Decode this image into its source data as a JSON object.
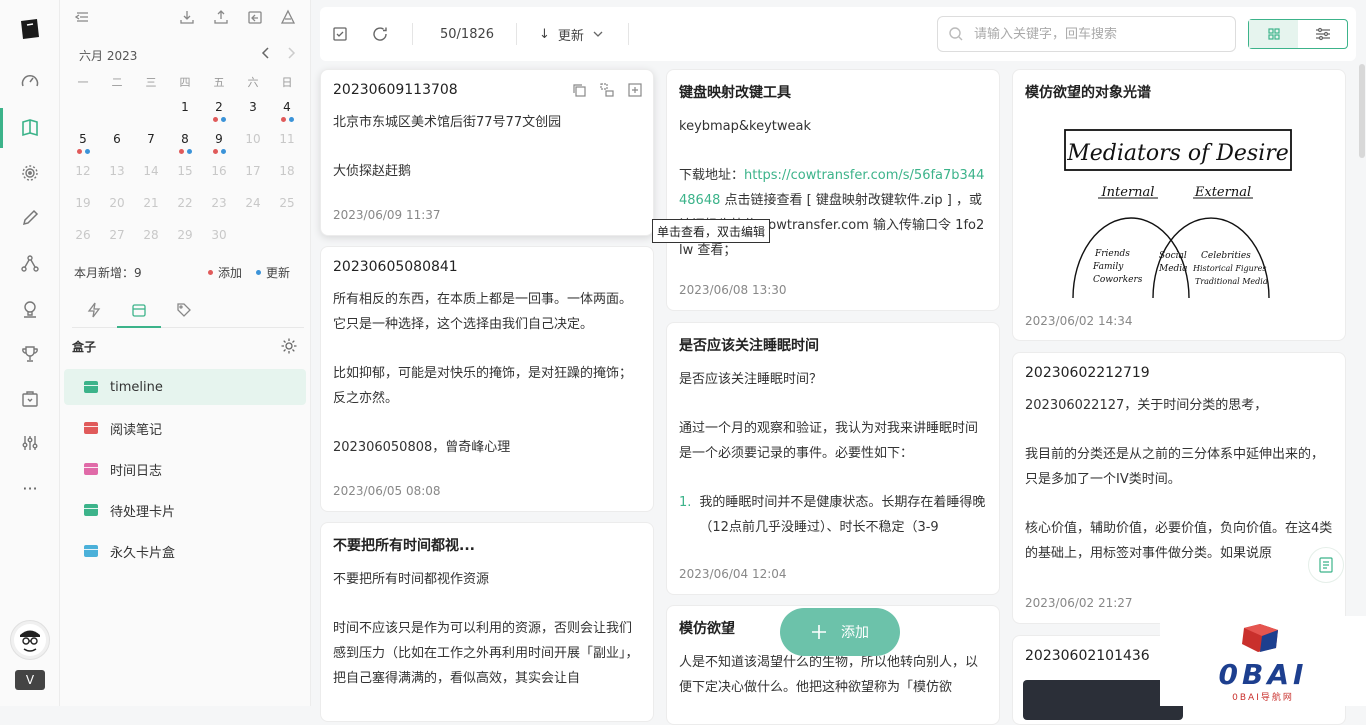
{
  "sidebar": {
    "calendar": {
      "title": "六月 2023",
      "weekdays": [
        "一",
        "二",
        "三",
        "四",
        "五",
        "六",
        "日"
      ],
      "rows": [
        [
          {
            "d": ""
          },
          {
            "d": ""
          },
          {
            "d": ""
          },
          {
            "d": "1"
          },
          {
            "d": "2",
            "dots": [
              "red",
              "blue"
            ]
          },
          {
            "d": "3"
          },
          {
            "d": "4",
            "dots": [
              "red",
              "blue"
            ]
          }
        ],
        [
          {
            "d": "5",
            "dots": [
              "red",
              "blue"
            ]
          },
          {
            "d": "6"
          },
          {
            "d": "7"
          },
          {
            "d": "8",
            "dots": [
              "red",
              "blue"
            ]
          },
          {
            "d": "9",
            "dots": [
              "red",
              "blue"
            ]
          },
          {
            "d": "10",
            "dim": true
          },
          {
            "d": "11",
            "dim": true
          }
        ],
        [
          {
            "d": "12",
            "dim": true
          },
          {
            "d": "13",
            "dim": true
          },
          {
            "d": "14",
            "dim": true
          },
          {
            "d": "15",
            "dim": true
          },
          {
            "d": "16",
            "dim": true
          },
          {
            "d": "17",
            "dim": true
          },
          {
            "d": "18",
            "dim": true
          }
        ],
        [
          {
            "d": "19",
            "dim": true
          },
          {
            "d": "20",
            "dim": true
          },
          {
            "d": "21",
            "dim": true
          },
          {
            "d": "22",
            "dim": true
          },
          {
            "d": "23",
            "dim": true
          },
          {
            "d": "24",
            "dim": true
          },
          {
            "d": "25",
            "dim": true
          }
        ],
        [
          {
            "d": "26",
            "dim": true
          },
          {
            "d": "27",
            "dim": true
          },
          {
            "d": "28",
            "dim": true
          },
          {
            "d": "29",
            "dim": true
          },
          {
            "d": "30",
            "dim": true
          },
          {
            "d": ""
          },
          {
            "d": ""
          }
        ]
      ],
      "monthly_new": "本月新增：9",
      "legend_add": "添加",
      "legend_update": "更新"
    },
    "box_title": "盒子",
    "boxes": [
      {
        "label": "timeline",
        "color": "#3cb38a"
      },
      {
        "label": "阅读笔记",
        "color": "#e05a5a"
      },
      {
        "label": "时间日志",
        "color": "#e06aa8"
      },
      {
        "label": "待处理卡片",
        "color": "#3cb38a"
      },
      {
        "label": "永久卡片盒",
        "color": "#4ab0d9"
      }
    ]
  },
  "toolbar": {
    "count": "50/1826",
    "sort_label": "更新",
    "search_placeholder": "请输入关键字，回车搜索"
  },
  "cards": {
    "c1": {
      "title": "20230609113708",
      "lines": [
        "北京市东城区美术馆后街77号77文创园",
        "大侦探赵赶鹅"
      ],
      "date": "2023/06/09 11:37"
    },
    "c2": {
      "title": "20230605080841",
      "lines": [
        "所有相反的东西，在本质上都是一回事。一体两面。它只是一种选择，这个选择由我们自己决定。",
        "比如抑郁，可能是对快乐的掩饰，是对狂躁的掩饰；反之亦然。",
        "202306050808，曾奇峰心理"
      ],
      "date": "2023/06/05 08:08"
    },
    "c3": {
      "title": "不要把所有时间都视...",
      "lines": [
        "不要把所有时间都视作资源",
        "时间不应该只是作为可以利用的资源，否则会让我们感到压力（比如在工作之外再利用时间开展「副业」，把自己塞得满满的，看似高效，其实会让自"
      ]
    },
    "c4": {
      "title": "键盘映射改键工具",
      "line1": "keybmap&keytweak",
      "pre": "下载地址：",
      "link": "https://cowtransfer.com/s/56fa7b34448648",
      "post": " 点击链接查看 [ 键盘映射改键软件.zip ] ，或访问奶牛快传 cowtransfer.com 输入传输口令 1fo2lw 查看；",
      "date": "2023/06/08 13:30"
    },
    "c5": {
      "title": "是否应该关注睡眠时间",
      "lines": [
        "是否应该关注睡眠时间？",
        "通过一个月的观察和验证，我认为对我来讲睡眠时间是一个必须要记录的事件。必要性如下："
      ],
      "li_num": "1.",
      "li_text": "我的睡眠时间并不是健康状态。长期存在着睡得晚（12点前几乎没睡过）、时长不稳定（3-9",
      "date": "2023/06/04 12:04"
    },
    "c6": {
      "title": "模仿欲望",
      "lines": [
        "人是不知道该渴望什么的生物，所以他转向别人，以便下定决心做什么。他把这种欲望称为「模仿欲"
      ]
    },
    "c7": {
      "title": "模仿欲望的对象光谱",
      "img": {
        "heading": "Mediators of Desire",
        "left": "Internal",
        "right": "External",
        "l1": "Friends",
        "l2": "Family",
        "l3": "Coworkers",
        "m1": "Social",
        "m2": "Media",
        "r1": "Celebrities",
        "r2": "Historical Figures",
        "r3": "Traditional Media"
      },
      "date": "2023/06/02 14:34"
    },
    "c8": {
      "title": "20230602212719",
      "lines": [
        "202306022127，关于时间分类的思考，",
        "我目前的分类还是从之前的三分体系中延伸出来的，只是多加了一个IV类时间。",
        "核心价值，辅助价值，必要价值，负向价值。在这4类的基础上，用标签对事件做分类。如果说原"
      ],
      "date": "2023/06/02 21:27"
    },
    "c9": {
      "title": "20230602101436"
    }
  },
  "tooltip": "单击查看，双击编辑",
  "fab_label": "添加",
  "watermark": {
    "brand": "0BAI",
    "sub": "0BAI导航网"
  },
  "colors": {
    "accent": "#3cb38a",
    "dot_red": "#e05a5a",
    "dot_blue": "#3b93d8"
  }
}
